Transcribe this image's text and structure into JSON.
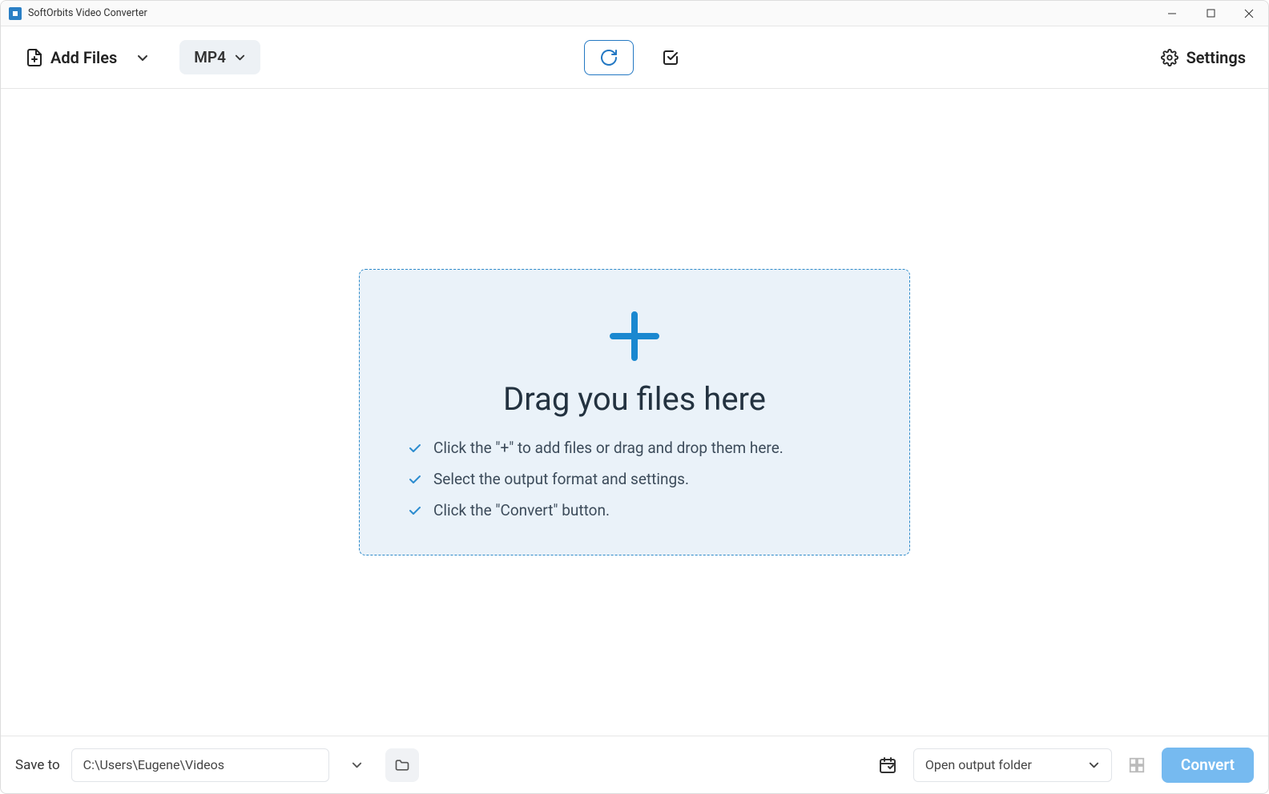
{
  "titlebar": {
    "title": "SoftOrbits Video Converter"
  },
  "toolbar": {
    "add_files_label": "Add Files",
    "format_label": "MP4",
    "settings_label": "Settings"
  },
  "dropzone": {
    "heading": "Drag you files here",
    "steps": [
      "Click the \"+\" to add files or drag and drop them here.",
      "Select the output format and settings.",
      "Click the \"Convert\" button."
    ]
  },
  "bottombar": {
    "saveto_label": "Save to",
    "path": "C:\\Users\\Eugene\\Videos",
    "open_folder_label": "Open output folder",
    "convert_label": "Convert"
  }
}
